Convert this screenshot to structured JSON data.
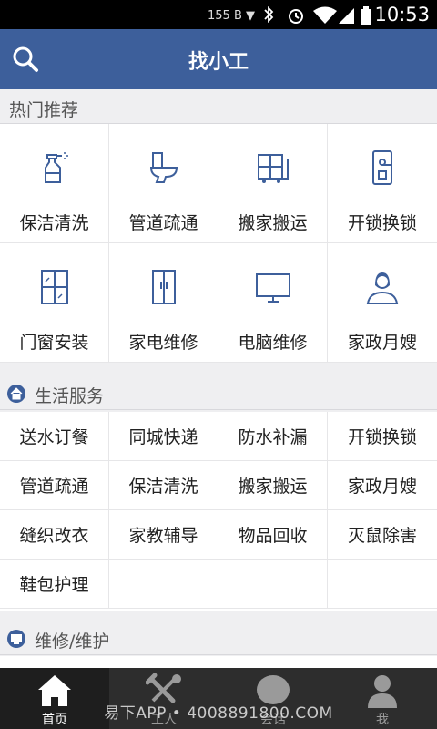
{
  "status": {
    "network": "155 B ▼",
    "time": "10:53"
  },
  "header": {
    "title": "找小工",
    "accent": "#3d5f9b"
  },
  "hot": {
    "title": "热门推荐",
    "items": [
      {
        "label": "保洁清洗",
        "icon": "spray-bottle-icon"
      },
      {
        "label": "管道疏通",
        "icon": "toilet-icon"
      },
      {
        "label": "搬家搬运",
        "icon": "moving-cart-icon"
      },
      {
        "label": "开锁换锁",
        "icon": "door-lock-icon"
      },
      {
        "label": "门窗安装",
        "icon": "window-icon"
      },
      {
        "label": "家电维修",
        "icon": "fridge-icon"
      },
      {
        "label": "电脑维修",
        "icon": "monitor-icon"
      },
      {
        "label": "家政月嫂",
        "icon": "housekeeper-icon"
      }
    ]
  },
  "life": {
    "title": "生活服务",
    "icon": "home-icon",
    "items": [
      "送水订餐",
      "同城快递",
      "防水补漏",
      "开锁换锁",
      "管道疏通",
      "保洁清洗",
      "搬家搬运",
      "家政月嫂",
      "缝织改衣",
      "家教辅导",
      "物品回收",
      "灭鼠除害",
      "鞋包护理",
      "",
      "",
      ""
    ]
  },
  "repair": {
    "title": "维修/维护",
    "icon": "monitor-icon"
  },
  "tabs": [
    {
      "label": "首页",
      "icon": "home-icon",
      "active": true
    },
    {
      "label": "工人",
      "icon": "tools-icon",
      "active": false
    },
    {
      "label": "会话",
      "icon": "chat-bubble-icon",
      "active": false
    },
    {
      "label": "我",
      "icon": "user-icon",
      "active": false
    }
  ],
  "watermark": "易下APP • 4008891800.COM"
}
